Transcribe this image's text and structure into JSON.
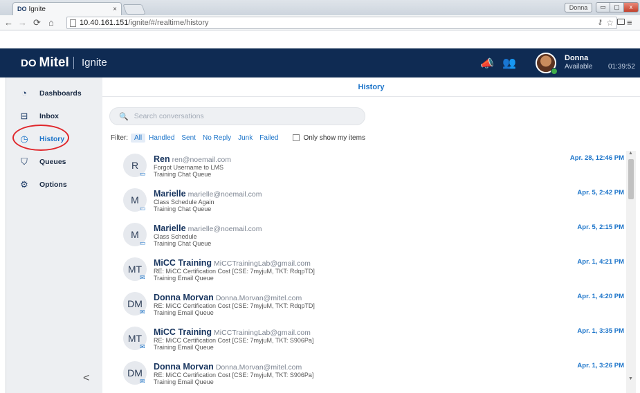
{
  "browser": {
    "tab_title": "Ignite",
    "tab_close": "×",
    "favicon_text": "DO",
    "user_badge": "Donna",
    "url_host": "10.40.161.151",
    "url_path": "/ignite/#/realtime/history",
    "win_min": "▭",
    "win_max": "▢",
    "win_close": "x"
  },
  "app": {
    "brand": "Mitel",
    "brand_mark": "DO",
    "product": "Ignite",
    "user_name": "Donna",
    "user_status": "Available",
    "clock": "01:39:52"
  },
  "sidebar": {
    "items": [
      {
        "label": "Dashboards",
        "icon": "gauge-icon"
      },
      {
        "label": "Inbox",
        "icon": "inbox-icon"
      },
      {
        "label": "History",
        "icon": "clock-icon"
      },
      {
        "label": "Queues",
        "icon": "queue-icon"
      },
      {
        "label": "Options",
        "icon": "gear-icon"
      }
    ],
    "active": "History",
    "collapse_glyph": "<"
  },
  "main": {
    "title": "History",
    "search_placeholder": "Search conversations",
    "filter_label": "Filter:",
    "filters": [
      "All",
      "Handled",
      "Sent",
      "No Reply",
      "Junk",
      "Failed"
    ],
    "selected_filter": "All",
    "only_mine_label": "Only show my items",
    "only_mine_checked": false,
    "conversations": [
      {
        "initials": "R",
        "name": "Ren",
        "email": "ren@noemail.com",
        "subject": "Forgot Username to LMS",
        "queue": "Training Chat Queue",
        "date": "Apr. 28, 12:46 PM",
        "type": "chat-icon"
      },
      {
        "initials": "M",
        "name": "Marielle",
        "email": "marielle@noemail.com",
        "subject": "Class Schedule Again",
        "queue": "Training Chat Queue",
        "date": "Apr. 5, 2:42 PM",
        "type": "chat-icon"
      },
      {
        "initials": "M",
        "name": "Marielle",
        "email": "marielle@noemail.com",
        "subject": "Class Schedule",
        "queue": "Training Chat Queue",
        "date": "Apr. 5, 2:15 PM",
        "type": "chat-icon"
      },
      {
        "initials": "MT",
        "name": "MiCC Training",
        "email": "MiCCTrainingLab@gmail.com",
        "subject": "RE: MiCC Certification Cost [CSE: 7myjuM, TKT: RdqpTD]",
        "queue": "Training Email Queue",
        "date": "Apr. 1, 4:21 PM",
        "type": "email-icon"
      },
      {
        "initials": "DM",
        "name": "Donna Morvan",
        "email": "Donna.Morvan@mitel.com",
        "subject": "RE: MiCC Certification Cost [CSE: 7myjuM, TKT: RdqpTD]",
        "queue": "Training Email Queue",
        "date": "Apr. 1, 4:20 PM",
        "type": "email-icon"
      },
      {
        "initials": "MT",
        "name": "MiCC Training",
        "email": "MiCCTrainingLab@gmail.com",
        "subject": "RE: MiCC Certification Cost [CSE: 7myjuM, TKT: S906Pa]",
        "queue": "Training Email Queue",
        "date": "Apr. 1, 3:35 PM",
        "type": "email-icon"
      },
      {
        "initials": "DM",
        "name": "Donna Morvan",
        "email": "Donna.Morvan@mitel.com",
        "subject": "RE: MiCC Certification Cost [CSE: 7myjuM, TKT: S906Pa]",
        "queue": "Training Email Queue",
        "date": "Apr. 1, 3:26 PM",
        "type": "email-icon"
      }
    ]
  },
  "colors": {
    "header_bg": "#0f2b53",
    "accent": "#1a73c9",
    "highlight_ring": "#e0262b",
    "presence": "#3fae49"
  }
}
